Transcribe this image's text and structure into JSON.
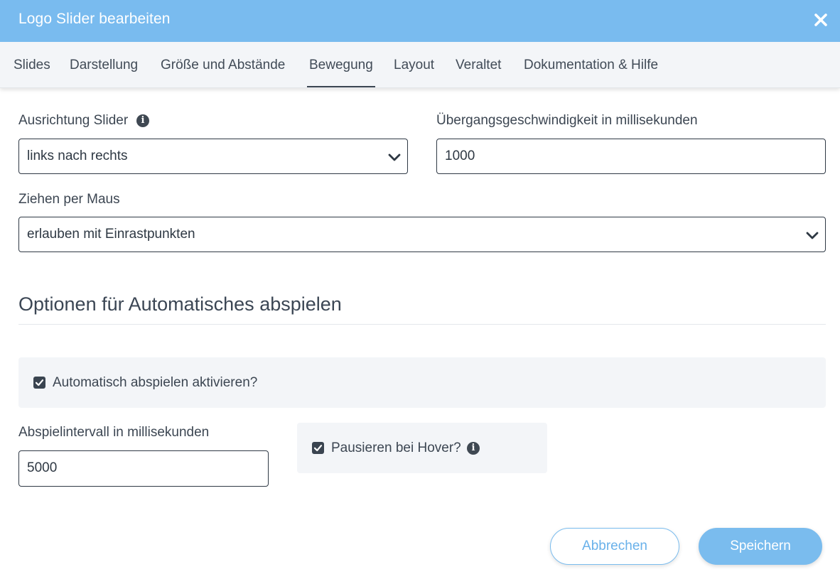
{
  "dialog": {
    "title": "Logo Slider bearbeiten",
    "close_icon": "close-icon"
  },
  "tabs": [
    {
      "label": "Slides",
      "active": false
    },
    {
      "label": "Darstellung",
      "active": false
    },
    {
      "label": "Größe und Abstände",
      "active": false
    },
    {
      "label": "Bewegung",
      "active": true
    },
    {
      "label": "Layout",
      "active": false
    },
    {
      "label": "Veraltet",
      "active": false
    },
    {
      "label": "Dokumentation & Hilfe",
      "active": false
    }
  ],
  "fields": {
    "alignment": {
      "label": "Ausrichtung Slider",
      "value": "links nach rechts",
      "icon": "info-icon"
    },
    "transition_speed": {
      "label": "Übergangsgeschwindigkeit in millisekunden",
      "value": "1000"
    },
    "mouse_drag": {
      "label": "Ziehen per Maus",
      "value": "erlauben mit Einrastpunkten"
    }
  },
  "autoplay": {
    "section_title": "Optionen für Automatisches abspielen",
    "enable": {
      "label": "Automatisch abspielen aktivieren?",
      "checked": true
    },
    "interval": {
      "label": "Abspielintervall in millisekunden",
      "value": "5000"
    },
    "pause_on_hover": {
      "label": "Pausieren bei Hover?",
      "checked": true,
      "icon": "info-icon"
    }
  },
  "footer": {
    "cancel_label": "Abbrechen",
    "save_label": "Speichern"
  },
  "colors": {
    "header_bg": "#79bbef",
    "accent": "#7abcee",
    "panel_bg": "#f3f5f8",
    "text": "#3c4652"
  }
}
